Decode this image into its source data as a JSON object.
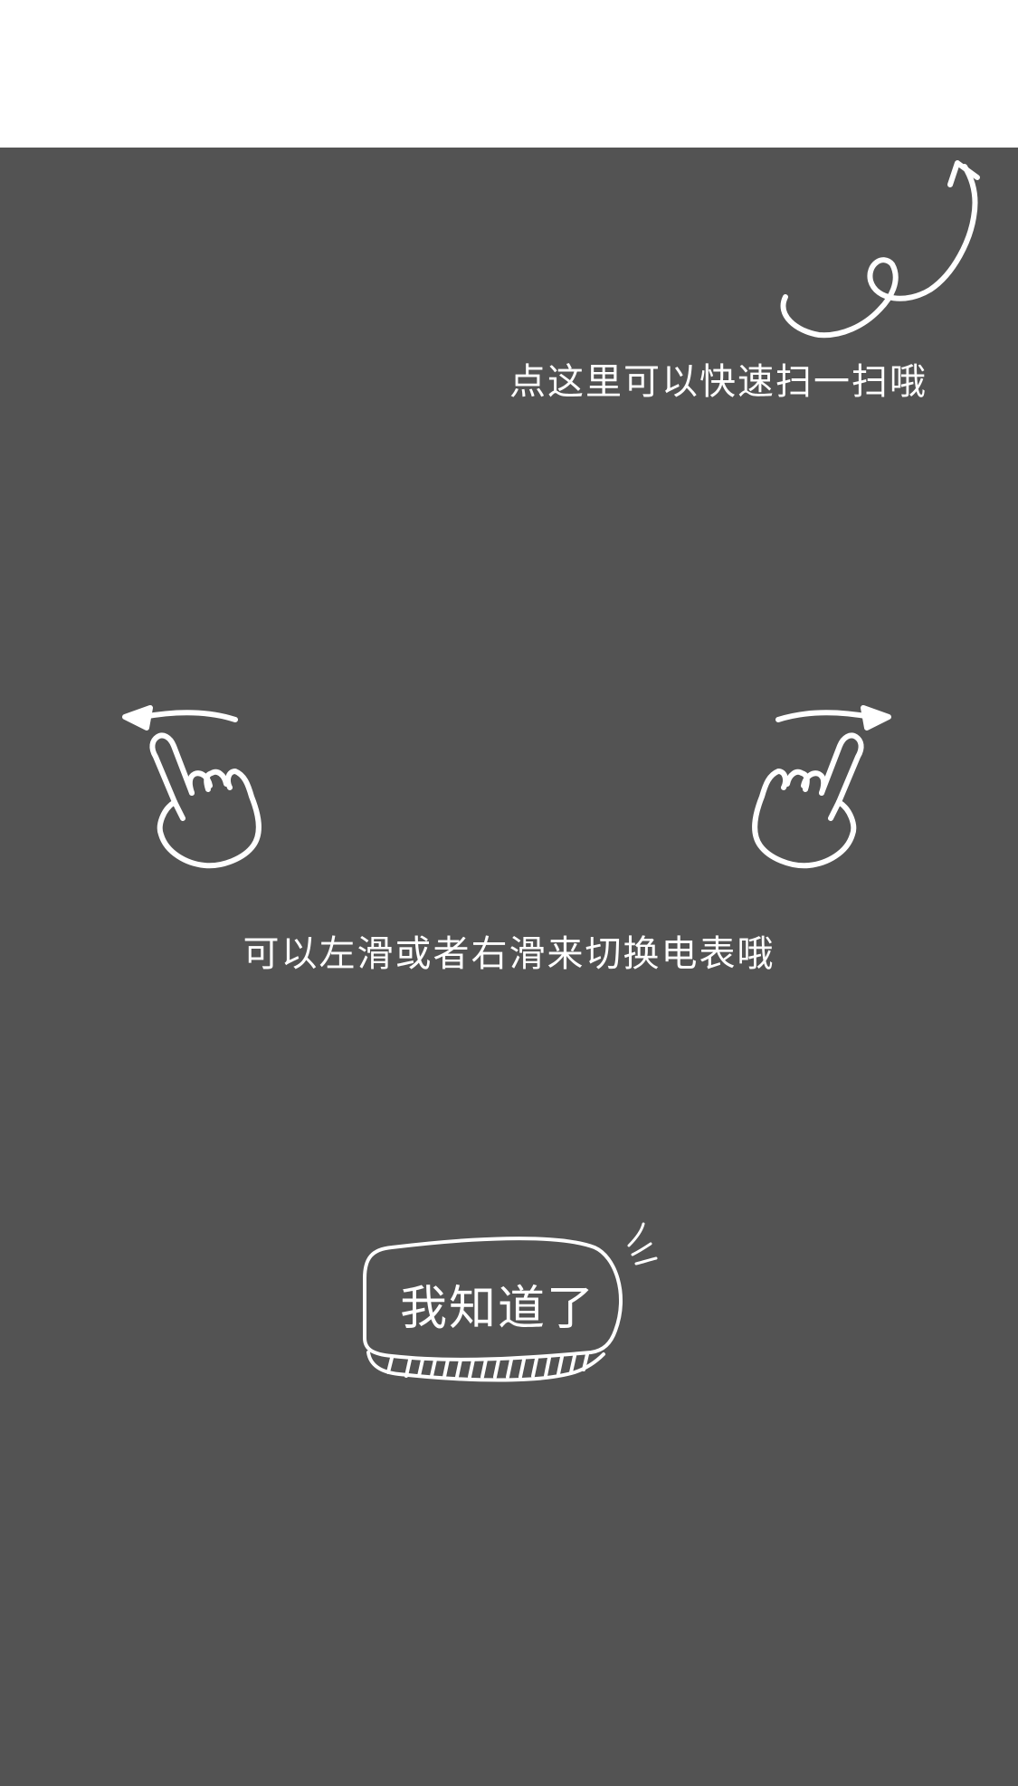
{
  "colors": {
    "top_bar": "#ffffff",
    "overlay": "#535353",
    "ink": "#ffffff"
  },
  "guide": {
    "scan_hint": "点这里可以快速扫一扫哦",
    "swipe_hint": "可以左滑或者右滑来切换电表哦",
    "confirm_button": "我知道了"
  },
  "icons": {
    "scan_arrow": "curly-arrow-up-right-icon",
    "swipe_left": "hand-swipe-left-icon",
    "swipe_right": "hand-swipe-right-icon",
    "sparkle": "sparkle-lines-icon"
  }
}
